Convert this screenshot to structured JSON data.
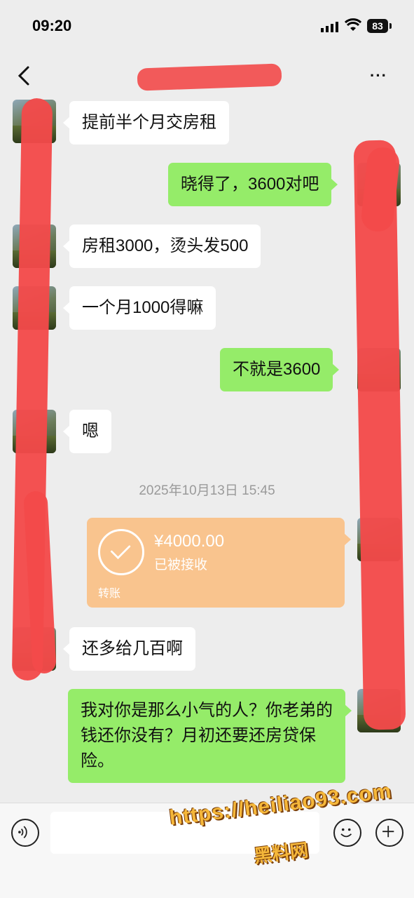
{
  "status_bar": {
    "time": "09:20",
    "battery": "83"
  },
  "nav": {
    "title": "",
    "more_label": "···"
  },
  "messages": [
    {
      "side": "in",
      "text": "提前半个月交房租"
    },
    {
      "side": "out",
      "text": "晓得了，3600对吧"
    },
    {
      "side": "in",
      "text": "房租3000，烫头发500"
    },
    {
      "side": "in",
      "text": "一个月1000得嘛"
    },
    {
      "side": "out",
      "text": "不就是3600"
    },
    {
      "side": "in",
      "text": "嗯"
    },
    {
      "side": "in",
      "text": "还多给几百啊"
    },
    {
      "side": "out",
      "text": "我对你是那么小气的人？你老弟的钱还你没有？月初还要还房贷保险。"
    }
  ],
  "timestamp": "2025年10月13日 15:45",
  "transfer": {
    "amount": "¥4000.00",
    "status": "已被接收",
    "label": "转账"
  },
  "colors": {
    "background": "#ededed",
    "bubble_out": "#95ec69",
    "bubble_in": "#ffffff",
    "transfer": "#f9c48e",
    "redaction": "#f24a4a"
  },
  "icons": [
    "back-icon",
    "more-icon",
    "signal-icon",
    "wifi-icon",
    "battery-icon",
    "voice-icon",
    "emoji-icon",
    "plus-icon",
    "check-icon"
  ],
  "watermark": {
    "url": "https://heiliao93.com",
    "name": "黑料网"
  }
}
